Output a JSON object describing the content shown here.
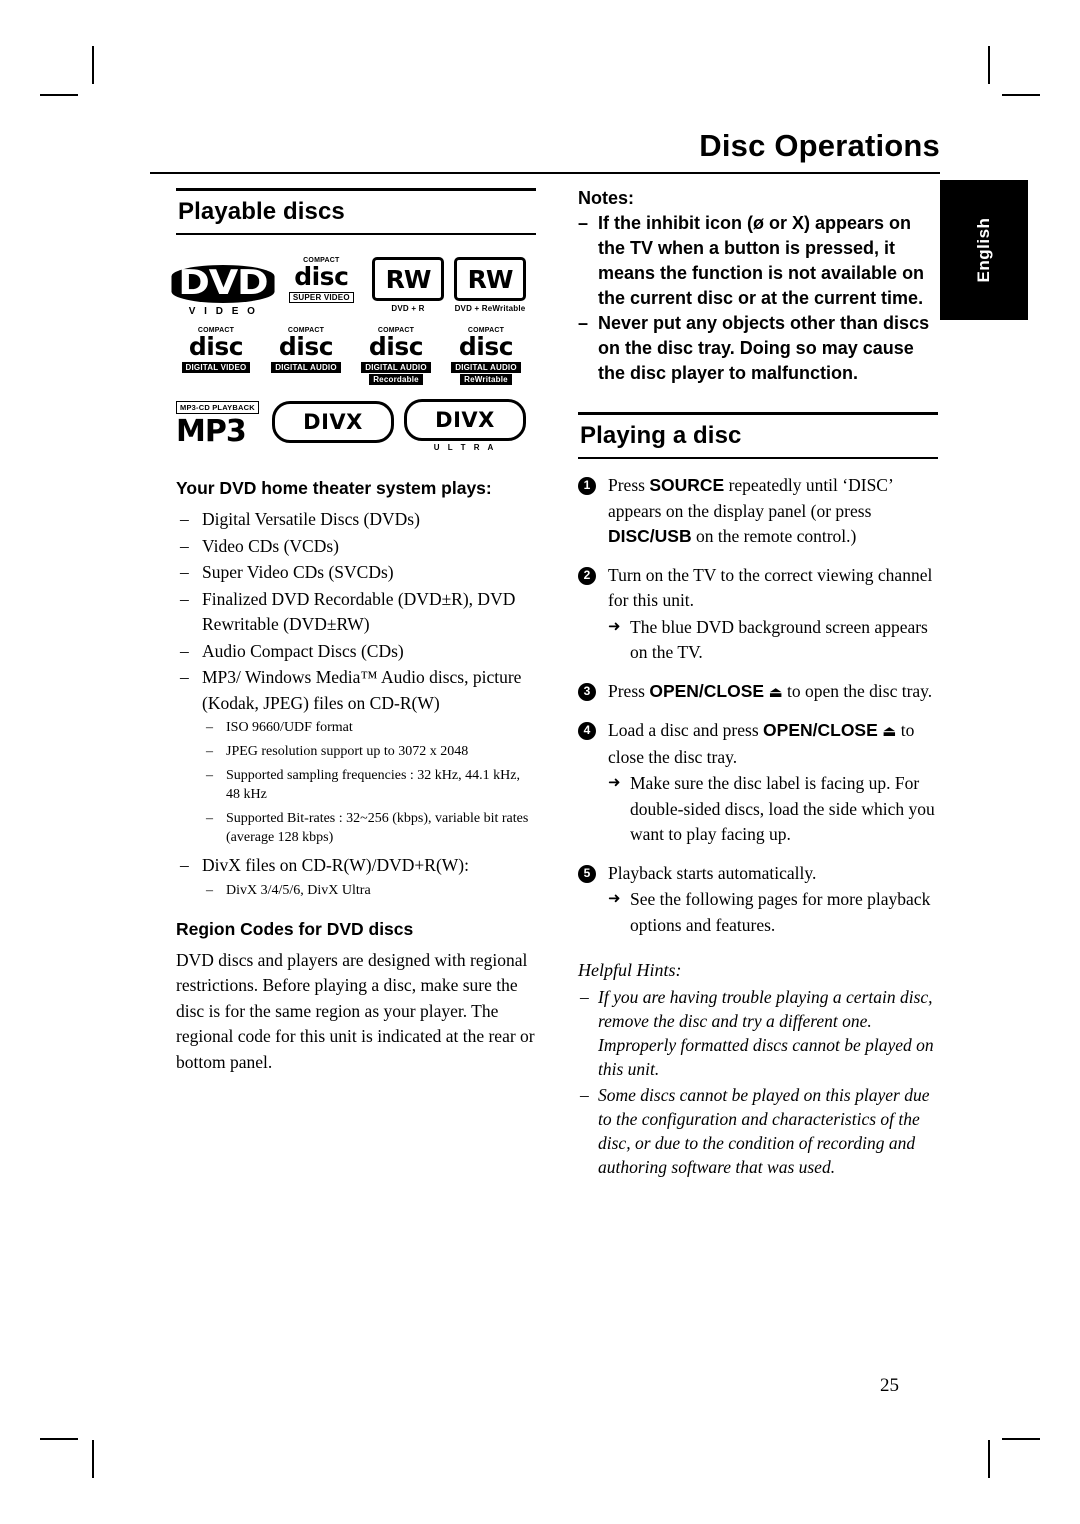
{
  "header": {
    "title": "Disc Operations",
    "language_tab": "English",
    "page_number": "25"
  },
  "left": {
    "section_title": "Playable discs",
    "logos": [
      {
        "name": "dvd-video-logo",
        "word": "DVD",
        "sub": "V I D E O"
      },
      {
        "name": "compact-disc-super-video-logo",
        "top1": "COMPACT",
        "word": "disc",
        "bar": "SUPER VIDEO"
      },
      {
        "name": "dvd-plus-r-logo",
        "word": "RW",
        "cap": "DVD + R"
      },
      {
        "name": "dvd-plus-rewritable-logo",
        "word": "RW",
        "cap": "DVD + ReWritable"
      },
      {
        "name": "compact-disc-digital-video-logo",
        "top1": "COMPACT",
        "word": "disc",
        "bar": "DIGITAL VIDEO"
      },
      {
        "name": "compact-disc-digital-audio-logo",
        "top1": "COMPACT",
        "word": "disc",
        "bar": "DIGITAL AUDIO"
      },
      {
        "name": "compact-disc-recordable-logo",
        "top1": "COMPACT",
        "word": "disc",
        "bar2": "DIGITAL AUDIO",
        "bar": "Recordable"
      },
      {
        "name": "compact-disc-rewritable-logo",
        "top1": "COMPACT",
        "word": "disc",
        "bar2": "DIGITAL AUDIO",
        "bar": "ReWritable"
      },
      {
        "name": "mp3-cd-playback-logo",
        "top": "MP3-CD PLAYBACK",
        "word": "MP3"
      },
      {
        "name": "divx-logo",
        "word": "DIVX"
      },
      {
        "name": "divx-ultra-logo",
        "word": "DIVX",
        "sub": "U L T R A"
      }
    ],
    "plays_heading": "Your DVD home theater system plays:",
    "plays_items": [
      "Digital Versatile Discs (DVDs)",
      "Video CDs (VCDs)",
      "Super Video CDs (SVCDs)",
      "Finalized DVD Recordable (DVD±R), DVD Rewritable (DVD±RW)",
      "Audio Compact Discs (CDs)"
    ],
    "mp3_item": "MP3/ Windows Media™ Audio discs, picture (Kodak, JPEG) files on CD-R(W)",
    "mp3_sub_items": [
      "ISO 9660/UDF format",
      "JPEG resolution support up to 3072 x 2048",
      "Supported sampling frequencies : 32 kHz, 44.1 kHz, 48 kHz",
      "Supported Bit-rates : 32~256 (kbps), variable bit rates (average 128 kbps)"
    ],
    "divx_item": "DivX files on CD-R(W)/DVD+R(W):",
    "divx_sub_items": [
      "DivX 3/4/5/6, DivX Ultra"
    ],
    "region_heading": "Region Codes for DVD discs",
    "region_text": "DVD discs and players are designed with regional restrictions. Before playing a disc, make sure the disc is for the same region as your player.  The regional code for this unit is indicated at the rear or bottom panel."
  },
  "right": {
    "notes_label": "Notes:",
    "notes": [
      "If the inhibit icon (ø or X) appears on the TV when a button is pressed, it means the function is not available on the current disc or at the current time.",
      "Never put any objects other than discs on the disc tray.  Doing so may cause the disc player to malfunction."
    ],
    "section_title": "Playing a disc",
    "steps": [
      {
        "num": "1",
        "text_parts": [
          {
            "t": "Press ",
            "b": false
          },
          {
            "t": "SOURCE",
            "b": true
          },
          {
            "t": " repeatedly until ‘DISC’ appears on the display panel (or press ",
            "b": false
          },
          {
            "t": "DISC/USB",
            "b": true
          },
          {
            "t": " on the remote control.)",
            "b": false
          }
        ]
      },
      {
        "num": "2",
        "text_parts": [
          {
            "t": "Turn on the TV to the correct viewing channel for this unit.",
            "b": false
          }
        ],
        "arrow": "The blue DVD background screen appears on the TV."
      },
      {
        "num": "3",
        "text_parts": [
          {
            "t": "Press ",
            "b": false
          },
          {
            "t": "OPEN/CLOSE",
            "b": true
          },
          {
            "t": " ⏏ to open the disc tray.",
            "b": false
          }
        ]
      },
      {
        "num": "4",
        "text_parts": [
          {
            "t": "Load a disc and press ",
            "b": false
          },
          {
            "t": "OPEN/CLOSE",
            "b": true
          },
          {
            "t": " ⏏ to close the disc tray.",
            "b": false
          }
        ],
        "arrow": "Make sure the disc label is facing up. For double-sided discs, load the side which you want to play facing up."
      },
      {
        "num": "5",
        "text_parts": [
          {
            "t": "Playback starts automatically.",
            "b": false
          }
        ],
        "arrow": "See the following pages for more playback options and features."
      }
    ],
    "hints_label": "Helpful Hints:",
    "hints": [
      "If you are having trouble playing a certain disc, remove the disc and try a different one. Improperly formatted discs cannot be played on this unit.",
      "Some discs cannot be played on this player due to the configuration and characteristics of the disc, or due to the condition of recording and authoring software that was used."
    ]
  }
}
